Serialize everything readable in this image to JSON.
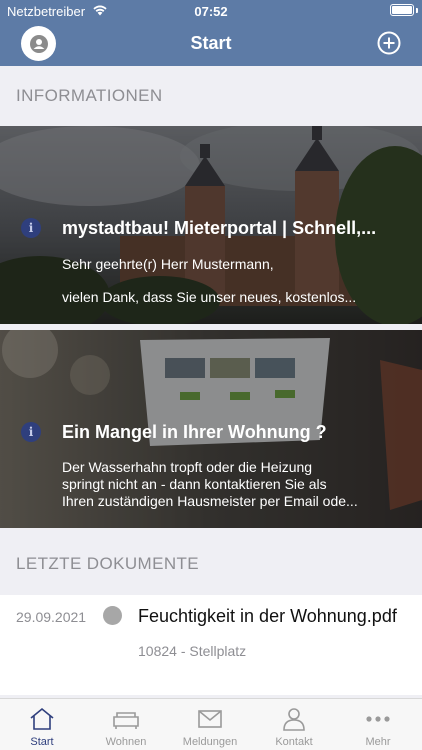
{
  "status_bar": {
    "carrier": "Netzbetreiber",
    "time": "07:52",
    "battery_level": 1.0
  },
  "nav": {
    "title": "Start"
  },
  "sections": {
    "informationen": "INFORMATIONEN",
    "dokumente": "LETZTE DOKUMENTE"
  },
  "news": [
    {
      "title": "mystadtbau! Mieterportal | Schnell,...",
      "line1": "Sehr geehrte(r) Herr Mustermann,",
      "line2": "vielen Dank, dass Sie unser neues, kostenlos..."
    },
    {
      "title": "Ein Mangel in Ihrer Wohnung ?",
      "line1": "Der Wasserhahn tropft oder die Heizung",
      "line2": "springt nicht an - dann kontaktieren Sie als",
      "line3": "Ihren zuständigen Hausmeister per Email ode..."
    }
  ],
  "documents": [
    {
      "date": "29.09.2021",
      "name": "Feuchtigkeit in der Wohnung.pdf",
      "sub": "10824 - Stellplatz"
    }
  ],
  "tabs": [
    {
      "label": "Start",
      "icon": "home-icon",
      "active": true
    },
    {
      "label": "Wohnen",
      "icon": "sofa-icon",
      "active": false
    },
    {
      "label": "Meldungen",
      "icon": "envelope-icon",
      "active": false
    },
    {
      "label": "Kontakt",
      "icon": "person-icon",
      "active": false
    },
    {
      "label": "Mehr",
      "icon": "more-dots-icon",
      "active": false
    }
  ],
  "colors": {
    "header": "#5d7ba6",
    "accent": "#2f3f7d",
    "background": "#efeff4"
  }
}
